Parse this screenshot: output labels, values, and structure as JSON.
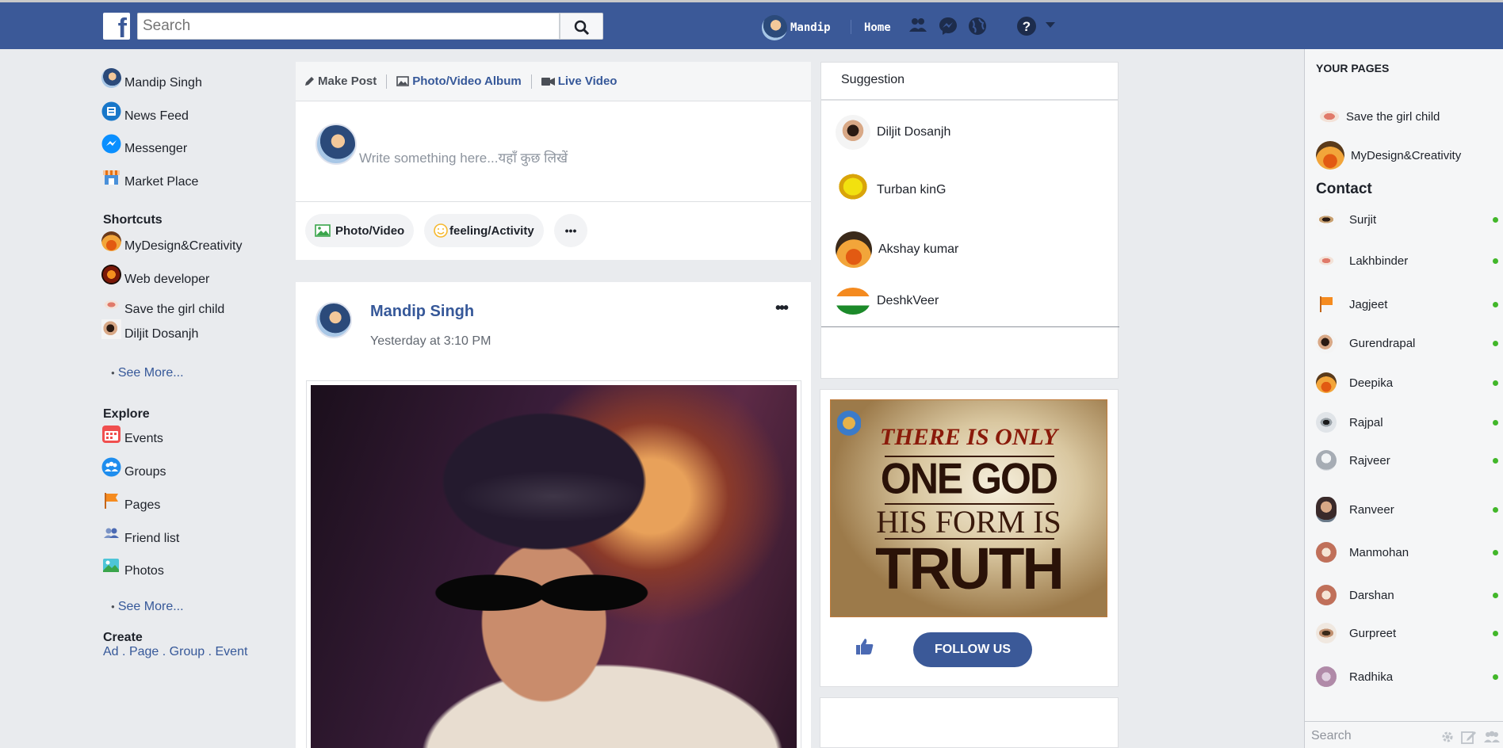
{
  "topbar": {
    "search_placeholder": "Search",
    "user_name": "Mandip",
    "home_label": "Home"
  },
  "left_nav": {
    "main": [
      {
        "label": "Mandip Singh",
        "icon": "profile-avatar"
      },
      {
        "label": "News Feed",
        "icon": "news-feed-icon"
      },
      {
        "label": "Messenger",
        "icon": "messenger-icon"
      },
      {
        "label": "Market Place",
        "icon": "marketplace-icon"
      }
    ],
    "shortcuts_title": "Shortcuts",
    "shortcuts": [
      {
        "label": "MyDesign&Creativity"
      },
      {
        "label": "Web developer"
      },
      {
        "label": "Save the girl child"
      },
      {
        "label": "Diljit Dosanjh"
      }
    ],
    "see_more_1": "See More...",
    "explore_title": "Explore",
    "explore": [
      {
        "label": "Events",
        "icon": "calendar-icon"
      },
      {
        "label": "Groups",
        "icon": "groups-icon"
      },
      {
        "label": "Pages",
        "icon": "flag-icon"
      },
      {
        "label": "Friend list",
        "icon": "friends-icon"
      },
      {
        "label": "Photos",
        "icon": "photos-icon"
      }
    ],
    "see_more_2": "See More...",
    "create_title": "Create",
    "create_links": {
      "ad": "Ad",
      "page": "Page",
      "group": "Group",
      "event": "Event",
      "sep": "."
    }
  },
  "composer": {
    "tabs": {
      "make_post": "Make Post",
      "album": "Photo/Video Album",
      "live": "Live Video"
    },
    "placeholder": "Write something here...यहाँ कुछ लिखें",
    "actions": {
      "photo": "Photo/Video",
      "feeling": "feeling/Activity",
      "more": "•••"
    }
  },
  "post": {
    "author": "Mandip Singh",
    "time": "Yesterday at 3:10 PM",
    "more": "•••"
  },
  "suggestion": {
    "title": "Suggestion",
    "items": [
      {
        "name": "Diljit Dosanjh"
      },
      {
        "name": "Turban kinG"
      },
      {
        "name": "Akshay kumar"
      },
      {
        "name": "DeshkVeer"
      }
    ]
  },
  "follow": {
    "poster_line1": "THERE IS ONLY",
    "poster_line2": "ONE GOD",
    "poster_line3": "HIS FORM IS",
    "poster_line4": "TRUTH",
    "button": "FOLLOW US"
  },
  "right": {
    "pages_title": "YOUR PAGES",
    "pages": [
      {
        "name": "Save the girl child"
      },
      {
        "name": "MyDesign&Creativity"
      }
    ],
    "contact_title": "Contact",
    "contacts": [
      {
        "name": "Surjit"
      },
      {
        "name": "Lakhbinder"
      },
      {
        "name": "Jagjeet"
      },
      {
        "name": "Gurendrapal"
      },
      {
        "name": "Deepika"
      },
      {
        "name": "Rajpal"
      },
      {
        "name": "Rajveer"
      },
      {
        "name": "Ranveer"
      },
      {
        "name": "Manmohan"
      },
      {
        "name": "Darshan"
      },
      {
        "name": "Gurpreet"
      },
      {
        "name": "Radhika"
      }
    ],
    "online_color": "#42b72a",
    "chat_search_placeholder": "Search"
  },
  "colors": {
    "brand": "#3b5998",
    "link": "#365899",
    "background": "#e9ebee"
  }
}
